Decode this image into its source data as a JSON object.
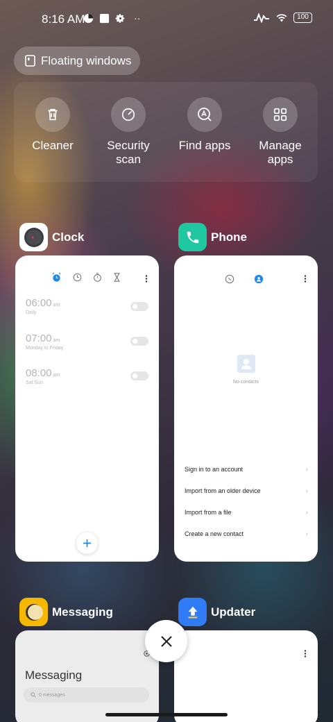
{
  "status_bar": {
    "time": "8:16 AM",
    "battery": "100",
    "more": "··"
  },
  "floating_windows": {
    "label": "Floating windows"
  },
  "quick_actions": [
    {
      "label": "Cleaner",
      "icon": "trash-icon"
    },
    {
      "label": "Security scan",
      "icon": "speedometer-icon"
    },
    {
      "label": "Find apps",
      "icon": "app-search-icon"
    },
    {
      "label": "Manage apps",
      "icon": "grid-icon"
    }
  ],
  "apps": {
    "clock": {
      "name": "Clock",
      "alarms": [
        {
          "time": "06:00",
          "period": "am",
          "repeat": "Daily"
        },
        {
          "time": "07:00",
          "period": "am",
          "repeat": "Monday to Friday"
        },
        {
          "time": "08:00",
          "period": "am",
          "repeat": "Sat Sun"
        }
      ]
    },
    "phone": {
      "name": "Phone",
      "empty_text": "No contacts",
      "options": [
        "Sign in to an account",
        "Import from an older device",
        "Import from a file",
        "Create a new contact"
      ]
    },
    "messaging": {
      "name": "Messaging",
      "title": "Messaging",
      "search_placeholder": "0 messages"
    },
    "updater": {
      "name": "Updater"
    }
  },
  "colors": {
    "accent": "#1f87f0",
    "phone_icon": "#1fc8a0",
    "updater_icon": "#2f7cf6",
    "messaging_icon": "#f5b800"
  }
}
